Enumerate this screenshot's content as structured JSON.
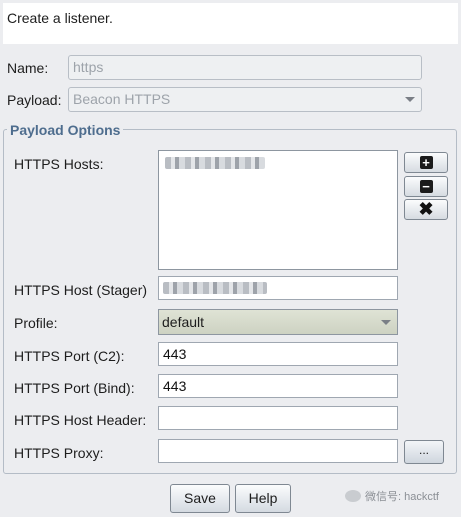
{
  "header": {
    "text": "Create a listener."
  },
  "name": {
    "label": "Name:",
    "value": "https"
  },
  "payload": {
    "label": "Payload:",
    "value": "Beacon HTTPS"
  },
  "payload_options": {
    "title": "Payload Options",
    "https_hosts_label": "HTTPS Hosts:",
    "https_host_stager_label": "HTTPS Host (Stager)",
    "profile_label": "Profile:",
    "profile_value": "default",
    "port_c2_label": "HTTPS Port (C2):",
    "port_c2_value": "443",
    "port_bind_label": "HTTPS Port (Bind):",
    "port_bind_value": "443",
    "host_header_label": "HTTPS Host Header:",
    "host_header_value": "",
    "proxy_label": "HTTPS Proxy:",
    "proxy_value": "",
    "proxy_button_label": "..."
  },
  "buttons": {
    "save": "Save",
    "help": "Help"
  },
  "watermark": {
    "text": "微信号: hackctf"
  }
}
